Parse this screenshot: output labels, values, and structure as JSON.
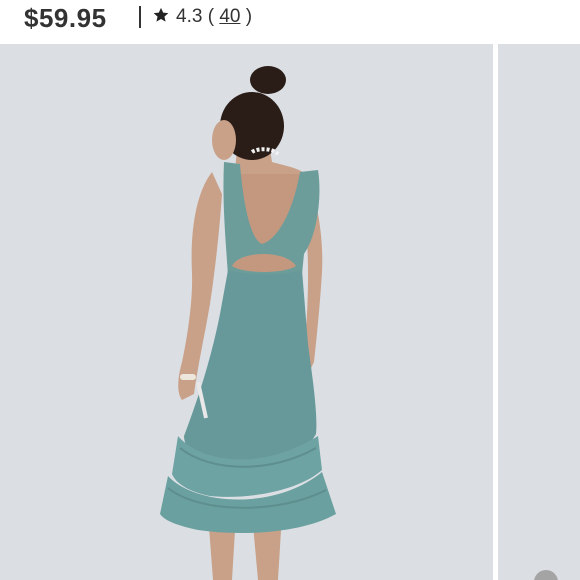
{
  "listing": {
    "price": "$59.95",
    "rating_value": "4.3",
    "rating_open": "(",
    "rating_count": "40",
    "rating_close": ")"
  },
  "gallery": {
    "background_color": "#dbdfe4",
    "dress_color": "#6c9d9b"
  },
  "icons": {
    "rating": "star-icon",
    "zoom": "zoom-icon"
  }
}
